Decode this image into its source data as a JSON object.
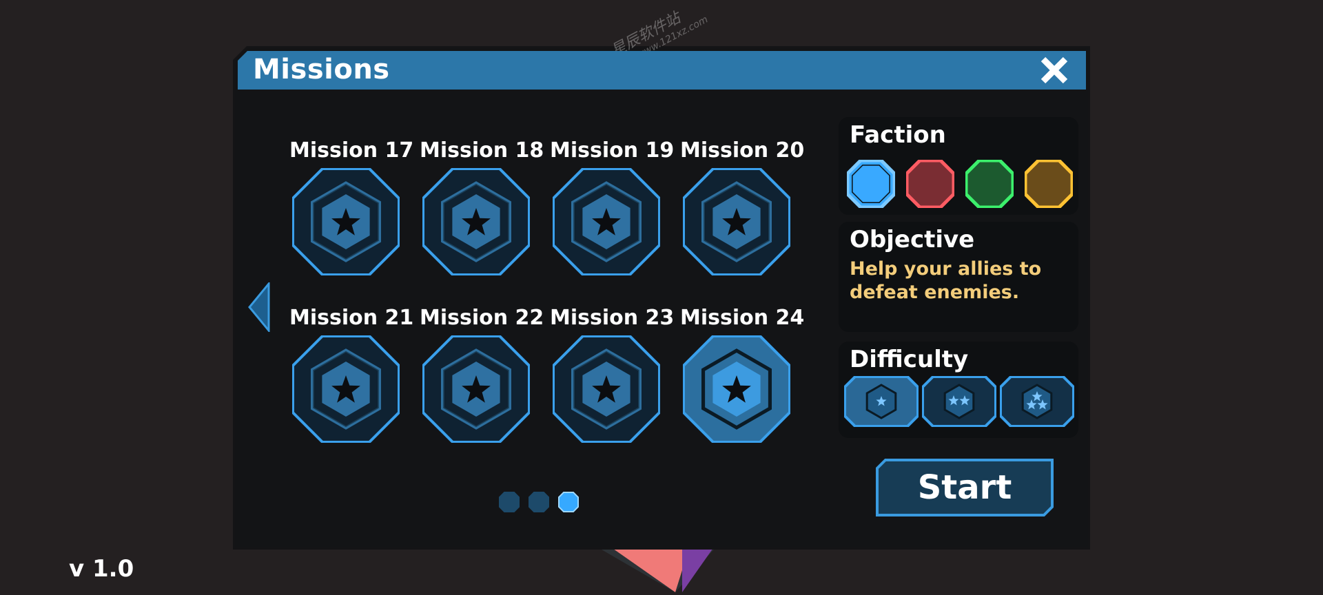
{
  "header": {
    "title": "Missions"
  },
  "missions": [
    {
      "label": "Mission 17"
    },
    {
      "label": "Mission 18"
    },
    {
      "label": "Mission 19"
    },
    {
      "label": "Mission 20"
    },
    {
      "label": "Mission 21"
    },
    {
      "label": "Mission 22"
    },
    {
      "label": "Mission 23"
    },
    {
      "label": "Mission 24"
    }
  ],
  "selected_mission": "Mission 24",
  "pagination": {
    "pages": 3,
    "current_page": 3
  },
  "faction": {
    "title": "Faction",
    "options": [
      {
        "name": "blue",
        "fill": "#39a9ff",
        "border": "#7cc9ff",
        "selected": true
      },
      {
        "name": "red",
        "fill": "#7a2d33",
        "border": "#ff5c63",
        "selected": false
      },
      {
        "name": "green",
        "fill": "#1c5a2f",
        "border": "#3cf06c",
        "selected": false
      },
      {
        "name": "yellow",
        "fill": "#6a4c1a",
        "border": "#ffc233",
        "selected": false
      }
    ]
  },
  "objective": {
    "title": "Objective",
    "text": "Help your allies to defeat enemies."
  },
  "difficulty": {
    "title": "Difficulty",
    "levels": [
      1,
      2,
      3
    ],
    "selected": 1
  },
  "start_button": {
    "label": "Start"
  },
  "version": "v 1.0",
  "watermark": {
    "name": "星辰软件站",
    "url": "www.121xz.com"
  },
  "colors": {
    "accent": "#2e86c1",
    "header": "#2c77a9",
    "objective_text": "#f3cd7b",
    "background": "#242021"
  }
}
